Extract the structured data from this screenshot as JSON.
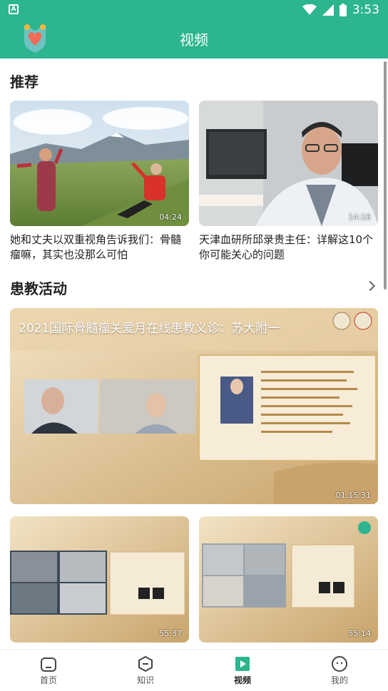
{
  "status": {
    "time": "3:53"
  },
  "header": {
    "title": "视频"
  },
  "sections": {
    "recommend": {
      "title": "推荐"
    },
    "activities": {
      "title": "患教活动"
    }
  },
  "recommend_videos": [
    {
      "title_line1": "她和丈夫以双重视角告诉我们：骨髓",
      "title_line2": "瘤嘛，其实也没那么可怕",
      "duration": "04:24"
    },
    {
      "title_line1": "天津血研所邱录贵主任：详解这10个",
      "title_line2": "你可能关心的问题",
      "duration": "14:16"
    }
  ],
  "featured_video": {
    "title": "2021国际骨髓瘤关爱月在线患教义诊：苏大附一",
    "duration": "01:15:31"
  },
  "grid_videos": [
    {
      "duration": "55:37"
    },
    {
      "duration": "55:14"
    }
  ],
  "tabs": [
    {
      "label": "首页",
      "active": false
    },
    {
      "label": "知识",
      "active": false
    },
    {
      "label": "视频",
      "active": true
    },
    {
      "label": "我的",
      "active": false
    }
  ],
  "colors": {
    "brand": "#2cb58f"
  }
}
